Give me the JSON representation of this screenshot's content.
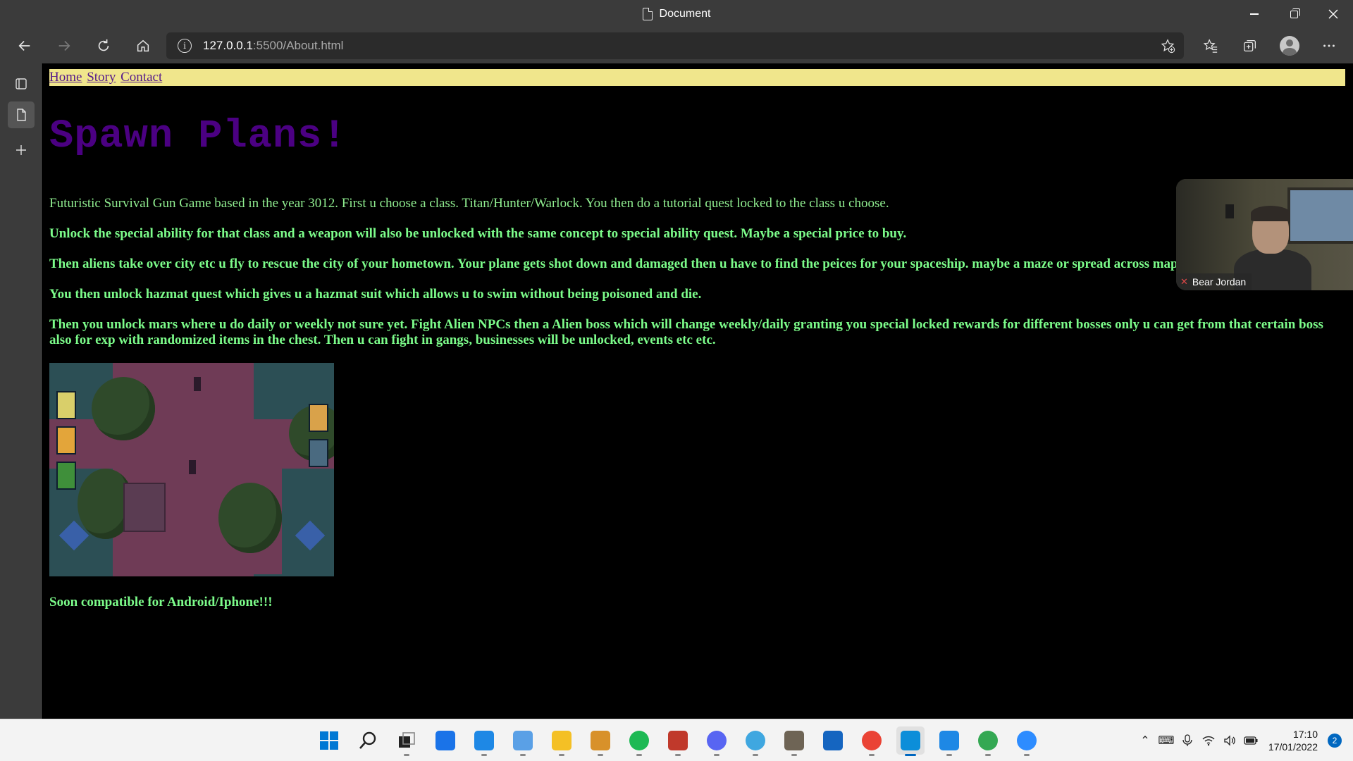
{
  "window": {
    "title": "Document"
  },
  "toolbar": {
    "url_host": "127.0.0.1",
    "url_path": ":5500/About.html"
  },
  "page": {
    "nav": [
      "Home",
      "Story",
      "Contact"
    ],
    "title": "Spawn Plans!",
    "paragraphs": [
      "Futuristic Survival Gun Game based in the year 3012. First u choose a class. Titan/Hunter/Warlock. You then do a tutorial quest locked to the class u choose.",
      "Unlock the special ability for that class and a weapon will also be unlocked with the same concept to special ability quest. Maybe a special price to buy.",
      "Then aliens take over city etc u fly to rescue the city of your hometown. Your plane gets shot down and damaged then u have to find the peices for your spaceship. maybe a maze or spread across map......",
      "You then unlock hazmat quest which gives u a hazmat suit which allows u to swim without being poisoned and die.",
      "Then you unlock mars where u do daily or weekly not sure yet. Fight Alien NPCs then a Alien boss which will change weekly/daily granting you special locked rewards for different bosses only u can get from that certain boss also for exp with randomized items in the chest. Then u can fight in gangs, businesses will be unlocked, events etc etc."
    ],
    "footer_text": "Soon compatible for Android/Iphone!!!",
    "colors": {
      "nav_bg": "#f0e68c",
      "title": "#4b0082",
      "text": "#7cfc8a",
      "background": "#000000"
    }
  },
  "webcam": {
    "name": "Bear Jordan",
    "mic_icon": "mic-off-icon"
  },
  "taskbar": {
    "apps": [
      {
        "name": "start",
        "color": "#0078d4"
      },
      {
        "name": "search",
        "color": "#222222"
      },
      {
        "name": "task-view",
        "color": "#222222"
      },
      {
        "name": "widgets",
        "color": "#1a73e8"
      },
      {
        "name": "mail",
        "color": "#1e88e5"
      },
      {
        "name": "notepad",
        "color": "#5aa0e6"
      },
      {
        "name": "file-explorer",
        "color": "#f4c025"
      },
      {
        "name": "game-app",
        "color": "#d8912a"
      },
      {
        "name": "spotify",
        "color": "#1db954"
      },
      {
        "name": "game-app-2",
        "color": "#c0392b"
      },
      {
        "name": "discord",
        "color": "#5865f2"
      },
      {
        "name": "paint-app",
        "color": "#3fa7e0"
      },
      {
        "name": "gimp",
        "color": "#6e6455"
      },
      {
        "name": "microsoft-store",
        "color": "#1565c0"
      },
      {
        "name": "chrome",
        "color": "#ea4335"
      },
      {
        "name": "edge",
        "color": "#0c8ed9"
      },
      {
        "name": "vscode",
        "color": "#1e88e5"
      },
      {
        "name": "chrome-2",
        "color": "#34a853"
      },
      {
        "name": "zoom",
        "color": "#2d8cff"
      }
    ],
    "time": "17:10",
    "date": "17/01/2022",
    "notifications": "2"
  }
}
